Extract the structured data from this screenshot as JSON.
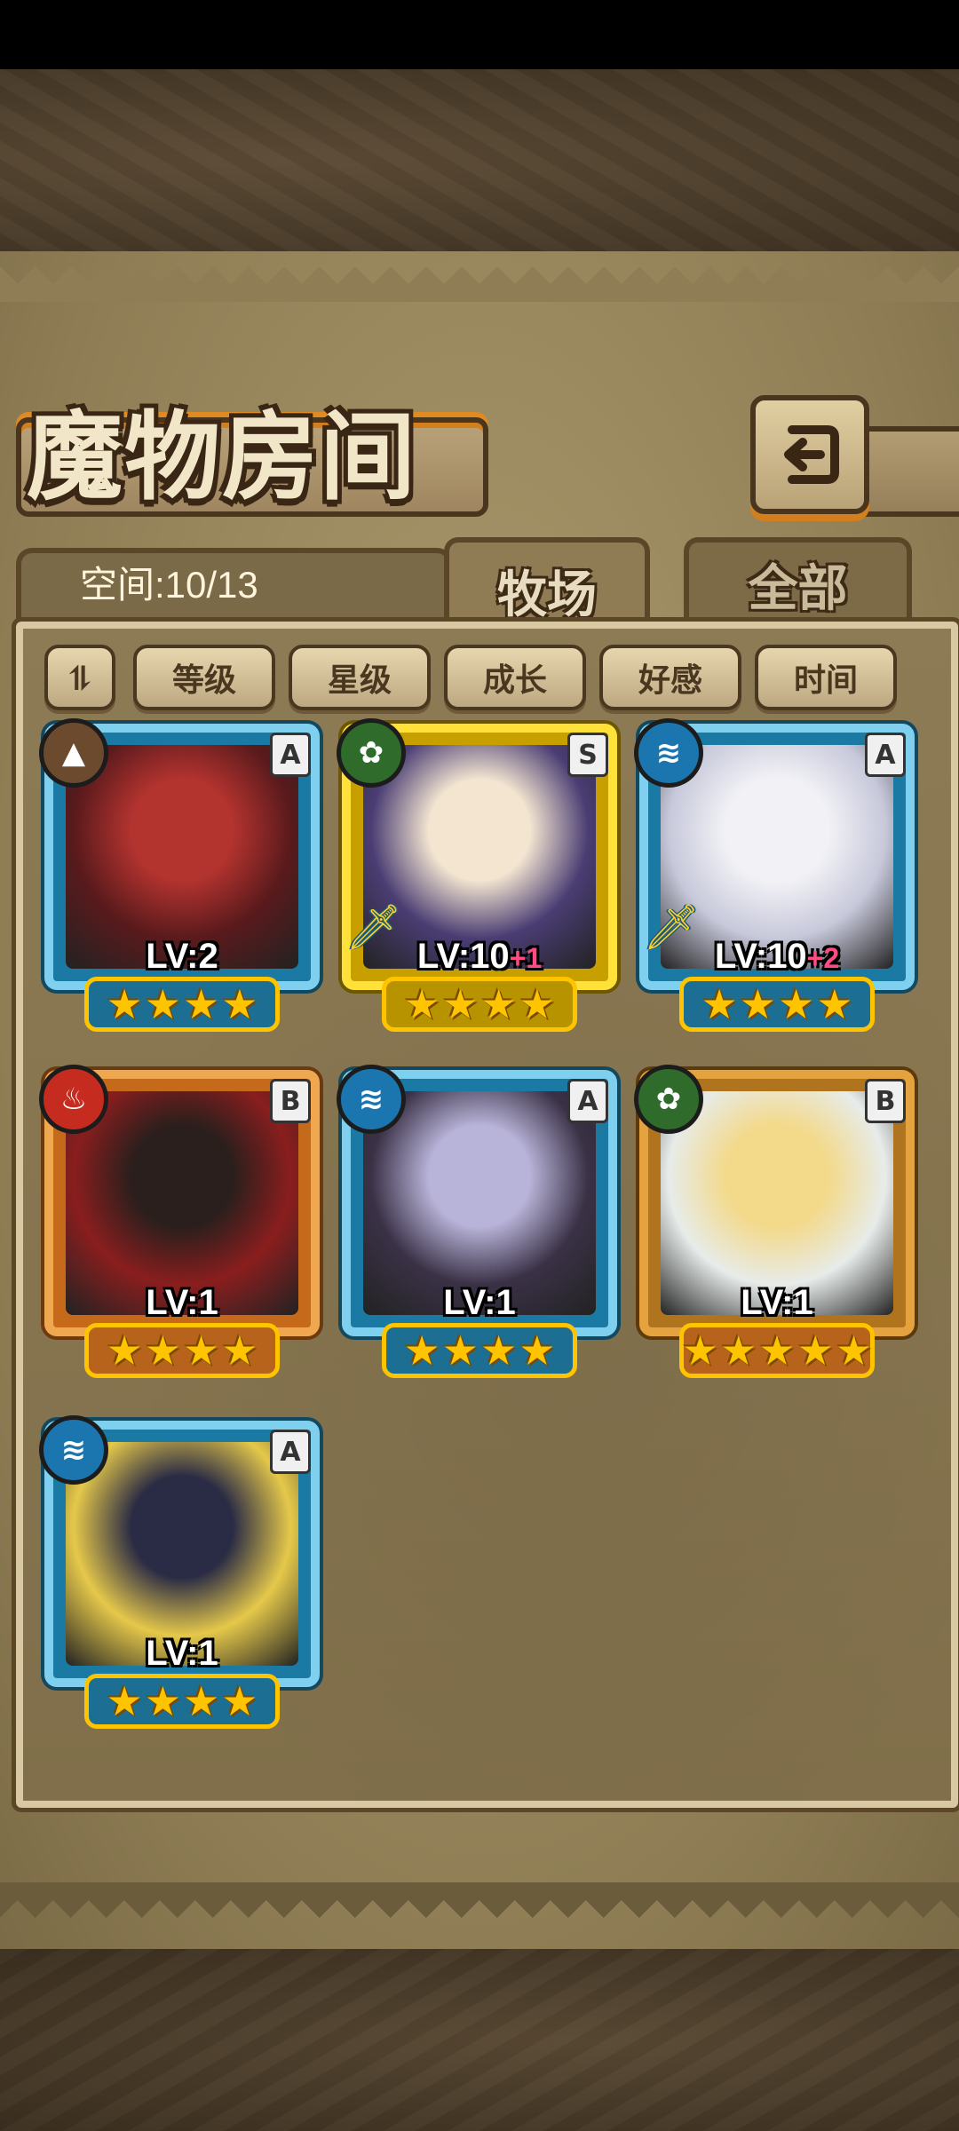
{
  "header": {
    "title": "魔物房间",
    "back_icon": "return-arrow-icon"
  },
  "space": {
    "label": "空间:10/13"
  },
  "tabs": [
    {
      "label": "牧场",
      "active": true
    },
    {
      "label": "全部",
      "active": false
    }
  ],
  "sort": {
    "order_icon": "sort-order-icon",
    "order_glyph": "⥮",
    "options": [
      "等级",
      "星级",
      "成长",
      "好感",
      "时间"
    ]
  },
  "monsters": [
    {
      "level": "LV:2",
      "plus": "",
      "rank": "A",
      "element": "earth",
      "element_glyph": "▲",
      "element_color": "#6b4a2e",
      "stars": 4,
      "frame": "blue",
      "weapon": false,
      "portrait_colors": [
        "#b3332f",
        "#5a1a1c"
      ]
    },
    {
      "level": "LV:10",
      "plus": "+1",
      "rank": "S",
      "element": "wind",
      "element_glyph": "✿",
      "element_color": "#2f6b2a",
      "stars": 4,
      "frame": "gold",
      "weapon": true,
      "portrait_colors": [
        "#f3e5d0",
        "#4a3d73"
      ]
    },
    {
      "level": "LV:10",
      "plus": "+2",
      "rank": "A",
      "element": "water",
      "element_glyph": "≋",
      "element_color": "#1b76b0",
      "stars": 4,
      "frame": "blue",
      "weapon": true,
      "portrait_colors": [
        "#f2f2f6",
        "#c7c8da"
      ]
    },
    {
      "level": "LV:1",
      "plus": "",
      "rank": "B",
      "element": "fire",
      "element_glyph": "♨",
      "element_color": "#c62b20",
      "stars": 4,
      "frame": "orange",
      "weapon": false,
      "portrait_colors": [
        "#2a1f1c",
        "#8a1e1e"
      ]
    },
    {
      "level": "LV:1",
      "plus": "",
      "rank": "A",
      "element": "water",
      "element_glyph": "≋",
      "element_color": "#1b76b0",
      "stars": 4,
      "frame": "blue",
      "weapon": false,
      "portrait_colors": [
        "#b8b3d8",
        "#3a3146"
      ]
    },
    {
      "level": "LV:1",
      "plus": "",
      "rank": "B",
      "element": "wind",
      "element_glyph": "✿",
      "element_color": "#2f6b2a",
      "stars": 5,
      "frame": "ornate",
      "weapon": false,
      "portrait_colors": [
        "#f3d98a",
        "#e7ecea"
      ]
    },
    {
      "level": "LV:1",
      "plus": "",
      "rank": "A",
      "element": "water",
      "element_glyph": "≋",
      "element_color": "#1b76b0",
      "stars": 4,
      "frame": "blue",
      "weapon": false,
      "portrait_colors": [
        "#2a2b45",
        "#e5c84a"
      ]
    }
  ]
}
